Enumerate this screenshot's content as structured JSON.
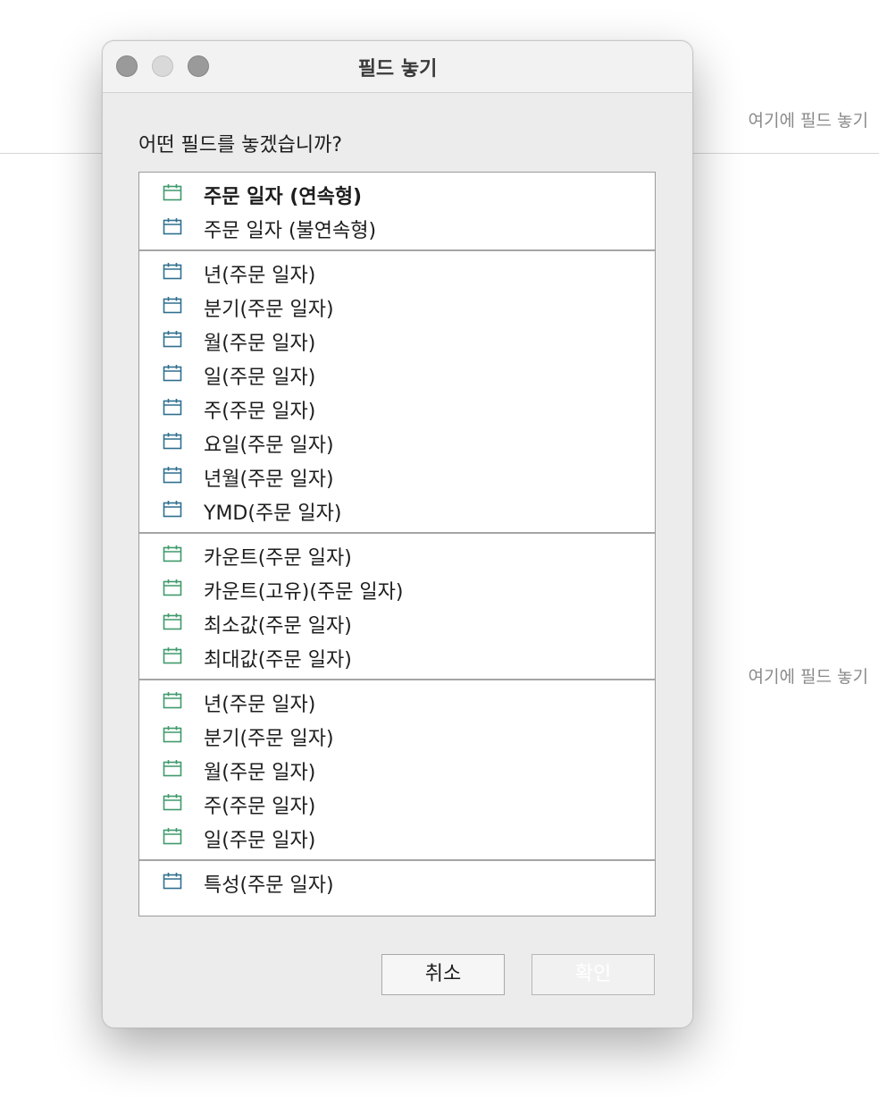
{
  "background": {
    "drop_hint_top": "여기에 필드 놓기",
    "drop_hint_bottom": "여기에 필드 놓기"
  },
  "dialog": {
    "title": "필드 놓기",
    "prompt": "어떤 필드를 놓겠습니까?",
    "buttons": {
      "cancel": "취소",
      "ok": "확인"
    }
  },
  "colors": {
    "icon_green": "#3f9a6c",
    "icon_blue": "#2f6f8f"
  },
  "groups": [
    {
      "items": [
        {
          "label": "주문 일자 (연속형)",
          "icon": "calendar-icon",
          "color": "green",
          "bold": true
        },
        {
          "label": "주문 일자 (불연속형)",
          "icon": "calendar-icon",
          "color": "blue",
          "bold": false
        }
      ]
    },
    {
      "items": [
        {
          "label": "년(주문 일자)",
          "icon": "calendar-icon",
          "color": "blue"
        },
        {
          "label": "분기(주문 일자)",
          "icon": "calendar-icon",
          "color": "blue"
        },
        {
          "label": "월(주문 일자)",
          "icon": "calendar-icon",
          "color": "blue"
        },
        {
          "label": "일(주문 일자)",
          "icon": "calendar-icon",
          "color": "blue"
        },
        {
          "label": "주(주문 일자)",
          "icon": "calendar-icon",
          "color": "blue"
        },
        {
          "label": "요일(주문 일자)",
          "icon": "calendar-icon",
          "color": "blue"
        },
        {
          "label": "년월(주문 일자)",
          "icon": "calendar-icon",
          "color": "blue"
        },
        {
          "label": "YMD(주문 일자)",
          "icon": "calendar-icon",
          "color": "blue"
        }
      ]
    },
    {
      "items": [
        {
          "label": "카운트(주문 일자)",
          "icon": "calendar-icon",
          "color": "green"
        },
        {
          "label": "카운트(고유)(주문 일자)",
          "icon": "calendar-icon",
          "color": "green"
        },
        {
          "label": "최소값(주문 일자)",
          "icon": "calendar-icon",
          "color": "green"
        },
        {
          "label": "최대값(주문 일자)",
          "icon": "calendar-icon",
          "color": "green"
        }
      ]
    },
    {
      "items": [
        {
          "label": "년(주문 일자)",
          "icon": "calendar-icon",
          "color": "green"
        },
        {
          "label": "분기(주문 일자)",
          "icon": "calendar-icon",
          "color": "green"
        },
        {
          "label": "월(주문 일자)",
          "icon": "calendar-icon",
          "color": "green"
        },
        {
          "label": "주(주문 일자)",
          "icon": "calendar-icon",
          "color": "green"
        },
        {
          "label": "일(주문 일자)",
          "icon": "calendar-icon",
          "color": "green"
        }
      ]
    },
    {
      "items": [
        {
          "label": "특성(주문 일자)",
          "icon": "calendar-icon",
          "color": "blue"
        }
      ]
    }
  ]
}
